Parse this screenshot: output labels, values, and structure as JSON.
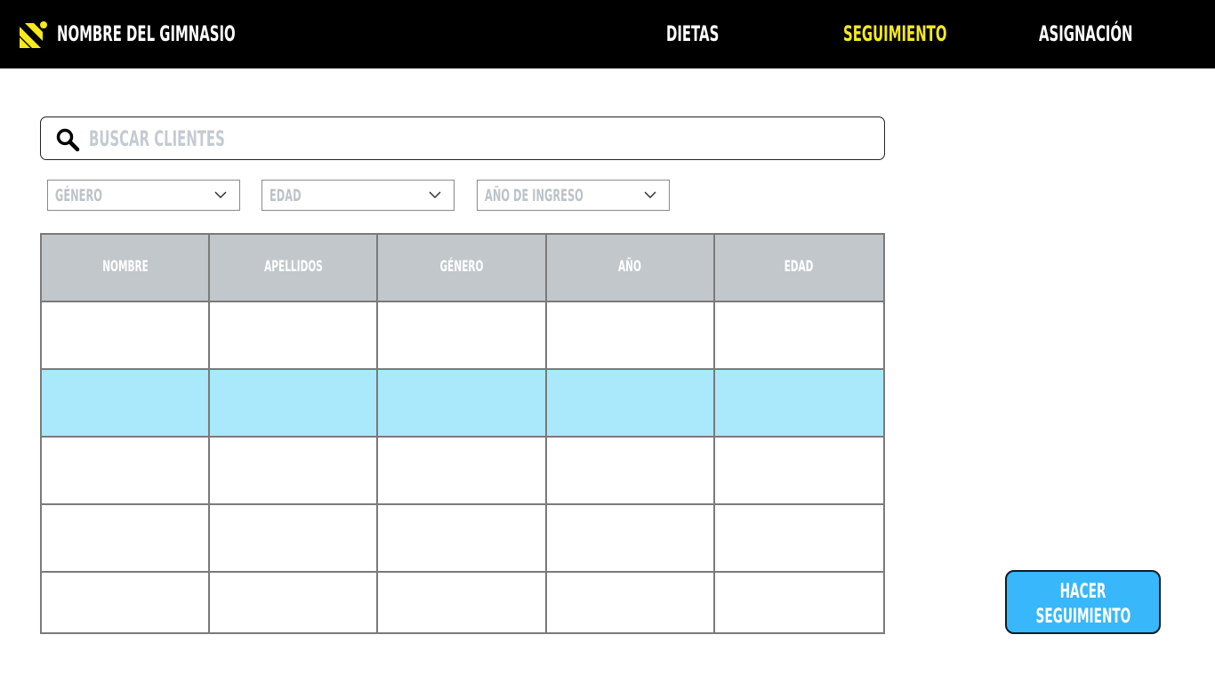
{
  "header": {
    "brand": "NOMBRE DEL GIMNASIO",
    "logo_icon": "gym-logo-icon",
    "nav": [
      {
        "label": "DIETAS",
        "active": false
      },
      {
        "label": "SEGUIMIENTO",
        "active": true
      },
      {
        "label": "ASIGNACIÓN",
        "active": false
      }
    ],
    "colors": {
      "background": "#000000",
      "text": "#ffffff",
      "active": "#f5ea1a",
      "logo": "#f5ea1a"
    }
  },
  "search": {
    "placeholder": "BUSCAR CLIENTES",
    "value": "",
    "icon": "search-icon"
  },
  "filters": [
    {
      "label": "GÉNERO",
      "icon": "chevron-down-icon"
    },
    {
      "label": "EDAD",
      "icon": "chevron-down-icon"
    },
    {
      "label": "AÑO DE INGRESO",
      "icon": "chevron-down-icon"
    }
  ],
  "table": {
    "columns": [
      "NOMBRE",
      "APELLIDOS",
      "GÉNERO",
      "AÑO",
      "EDAD"
    ],
    "rows": [
      [
        "",
        "",
        "",
        "",
        ""
      ],
      [
        "",
        "",
        "",
        "",
        ""
      ],
      [
        "",
        "",
        "",
        "",
        ""
      ],
      [
        "",
        "",
        "",
        "",
        ""
      ],
      [
        "",
        "",
        "",
        "",
        ""
      ]
    ],
    "selected_row": 1,
    "colors": {
      "header": "#c1c7cb",
      "selected": "#aae8fb",
      "border": "#7a7a7a"
    }
  },
  "action_button": {
    "lines": [
      "HACER",
      "SEGUIMIENTO"
    ],
    "color": "#38b7fb"
  }
}
